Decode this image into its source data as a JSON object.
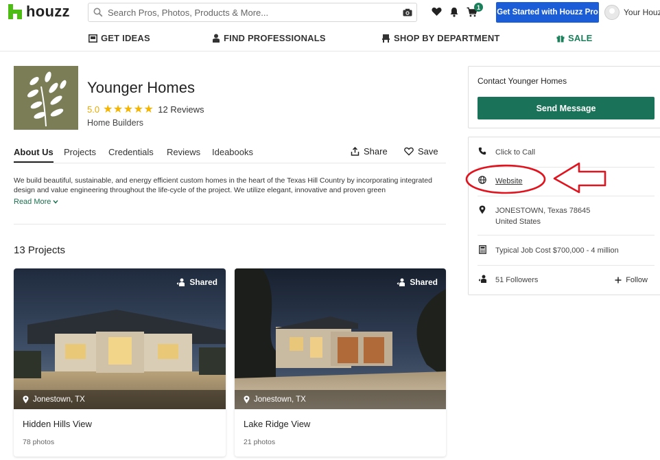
{
  "brand": {
    "name": "houzz",
    "color": "#4dbc15"
  },
  "search": {
    "placeholder": "Search Pros, Photos, Products & More..."
  },
  "header": {
    "cart_count": "1",
    "pro_button": "Get Started with Houzz Pro",
    "account_label": "Your Houzz"
  },
  "nav": [
    {
      "label": "GET IDEAS",
      "icon": "photo-book-icon"
    },
    {
      "label": "FIND PROFESSIONALS",
      "icon": "professional-icon"
    },
    {
      "label": "SHOP BY DEPARTMENT",
      "icon": "shopping-cart-icon"
    },
    {
      "label": "SALE",
      "icon": "gift-icon"
    }
  ],
  "profile": {
    "name": "Younger Homes",
    "rating": "5.0",
    "stars": "★★★★★",
    "reviews": "12 Reviews",
    "category": "Home Builders",
    "logo_color": "#7b7d56"
  },
  "tabs": [
    "About Us",
    "Projects",
    "Credentials",
    "Reviews",
    "Ideabooks"
  ],
  "actions": {
    "share": "Share",
    "save": "Save"
  },
  "about": {
    "text": "We build beautiful, sustainable, and energy efficient custom homes in the heart of the Texas Hill Country by incorporating integrated design and value engineering throughout the life-cycle of the project. We utilize elegant, innovative and proven green",
    "read_more": "Read More"
  },
  "projects": {
    "title": "13 Projects",
    "items": [
      {
        "shared": "Shared",
        "location": "Jonestown, TX",
        "title": "Hidden Hills View",
        "photos": "78 photos"
      },
      {
        "shared": "Shared",
        "location": "Jonestown, TX",
        "title": "Lake Ridge View",
        "photos": "21 photos"
      }
    ]
  },
  "contact": {
    "title": "Contact Younger Homes",
    "send_button": "Send Message",
    "accent": "#1a7258"
  },
  "info": {
    "call": "Click to Call",
    "website": "Website",
    "address_line1": "JONESTOWN, Texas 78645",
    "address_line2": "United States",
    "job_cost": "Typical Job Cost $700,000 - 4 million",
    "followers": "51 Followers",
    "follow": "Follow"
  },
  "annotation": {
    "color": "#e0141e"
  }
}
